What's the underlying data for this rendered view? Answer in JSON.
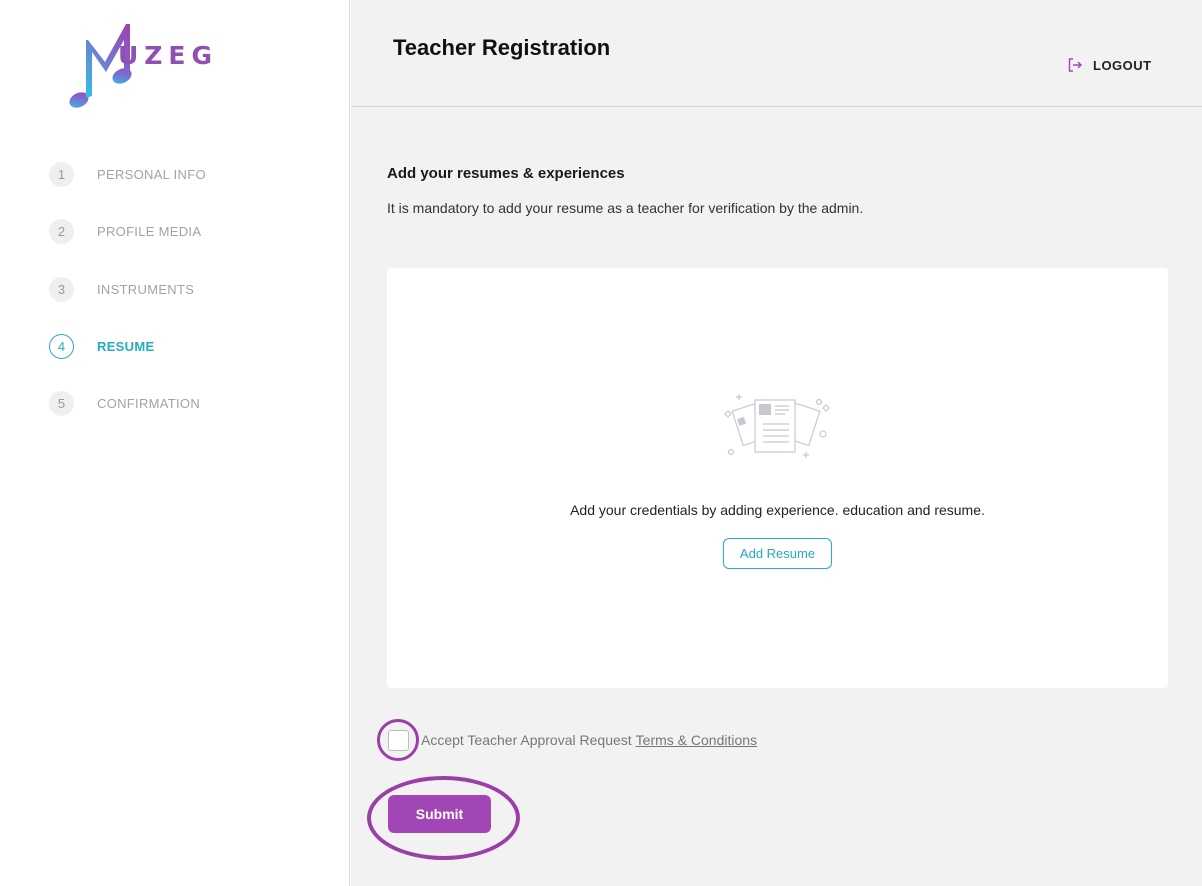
{
  "brand": {
    "name": "UZEG",
    "primary_color": "#a246b6",
    "accent_color": "#24aebc"
  },
  "steps": [
    {
      "num": "1",
      "label": "PERSONAL INFO"
    },
    {
      "num": "2",
      "label": "PROFILE MEDIA"
    },
    {
      "num": "3",
      "label": "INSTRUMENTS"
    },
    {
      "num": "4",
      "label": "RESUME",
      "active": true
    },
    {
      "num": "5",
      "label": "CONFIRMATION"
    }
  ],
  "header": {
    "title": "Teacher Registration",
    "logout_label": "LOGOUT"
  },
  "section": {
    "title": "Add your resumes & experiences",
    "subtitle": "It is mandatory to add your resume as a teacher for verification by the admin."
  },
  "card": {
    "message": "Add your credentials by adding experience. education and resume.",
    "button_label": "Add Resume",
    "illustration_icon": "resume-documents-icon"
  },
  "accept": {
    "text": "Accept Teacher Approval Request",
    "link_text": "Terms & Conditions",
    "checked": false
  },
  "submit_label": "Submit"
}
